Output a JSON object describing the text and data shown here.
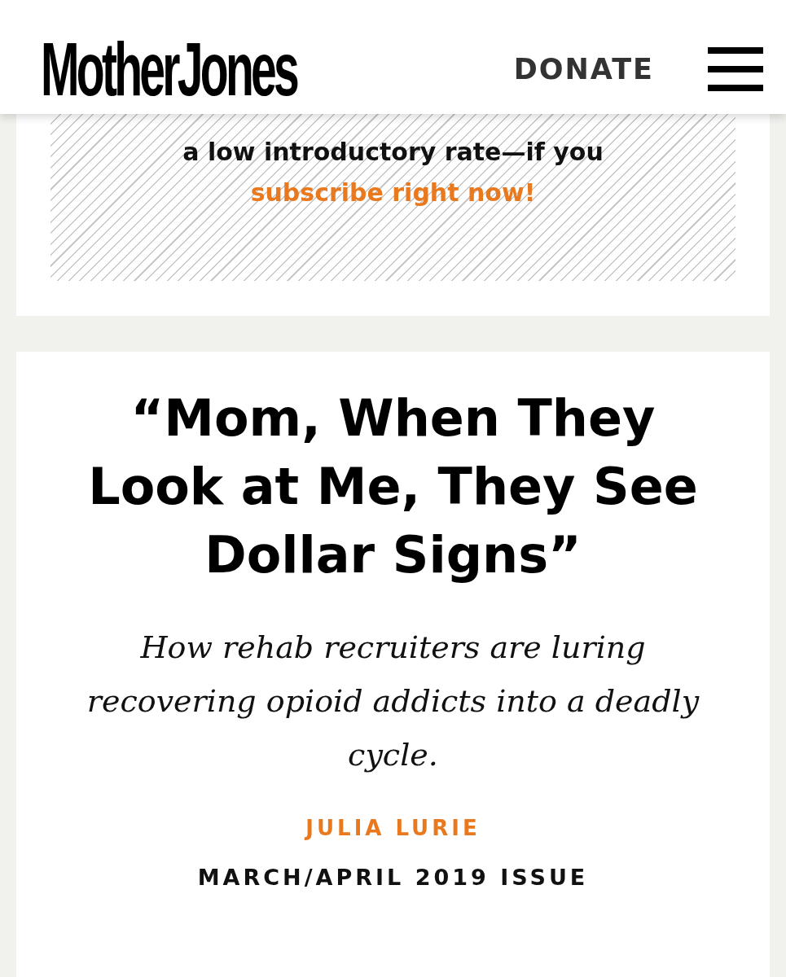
{
  "header": {
    "logo": "MotherJones",
    "donate": "DONATE"
  },
  "promo": {
    "lines": [
      "a low introductory rate—if you"
    ],
    "link": "subscribe right now!"
  },
  "article": {
    "title": "“Mom, When They Look at Me, They See Dollar Signs”",
    "dek": "How rehab recruiters are luring recovering opioid addicts into a deadly cycle.",
    "author": "JULIA LURIE",
    "issue": "MARCH/APRIL 2019 ISSUE"
  }
}
